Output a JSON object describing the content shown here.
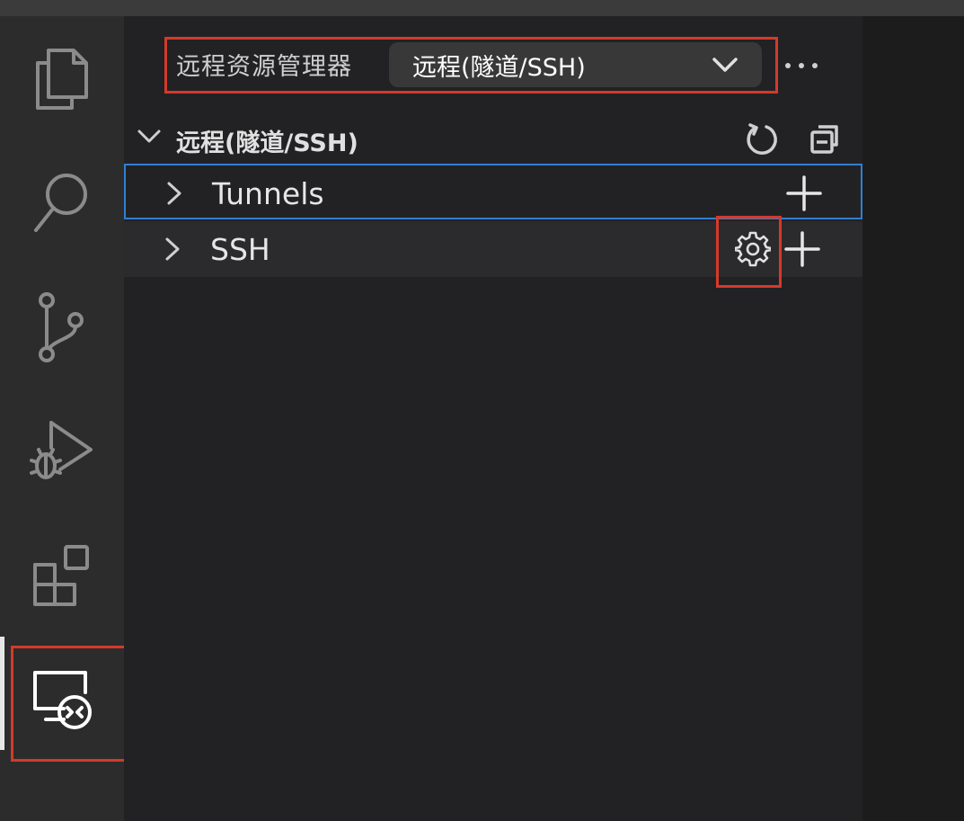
{
  "colors": {
    "accent_focus": "#2f7fd4",
    "highlight_annotation": "#d43a2a",
    "activity_bar": "#2c2c2c",
    "sidebar": "#222224"
  },
  "activity_bar": {
    "items": [
      {
        "name": "explorer",
        "icon": "files-icon"
      },
      {
        "name": "search",
        "icon": "search-icon"
      },
      {
        "name": "source-control",
        "icon": "source-control-icon"
      },
      {
        "name": "run-and-debug",
        "icon": "debug-icon"
      },
      {
        "name": "extensions",
        "icon": "extensions-icon"
      },
      {
        "name": "remote-explorer",
        "icon": "remote-explorer-icon",
        "active": true
      }
    ]
  },
  "sidebar": {
    "title": "远程资源管理器",
    "view_selector": {
      "selected": "远程(隧道/SSH)",
      "icon": "chevron-down-icon"
    },
    "more_icon": "ellipsis-icon",
    "section": {
      "title": "远程(隧道/SSH)",
      "expanded": true,
      "actions": [
        {
          "name": "refresh",
          "icon": "refresh-icon"
        },
        {
          "name": "collapse-all",
          "icon": "collapse-all-icon"
        }
      ]
    },
    "tree": [
      {
        "label": "Tunnels",
        "actions": [
          "add-icon"
        ],
        "focused": true
      },
      {
        "label": "SSH",
        "actions": [
          "gear-icon",
          "add-icon"
        ],
        "hover": true
      }
    ]
  }
}
